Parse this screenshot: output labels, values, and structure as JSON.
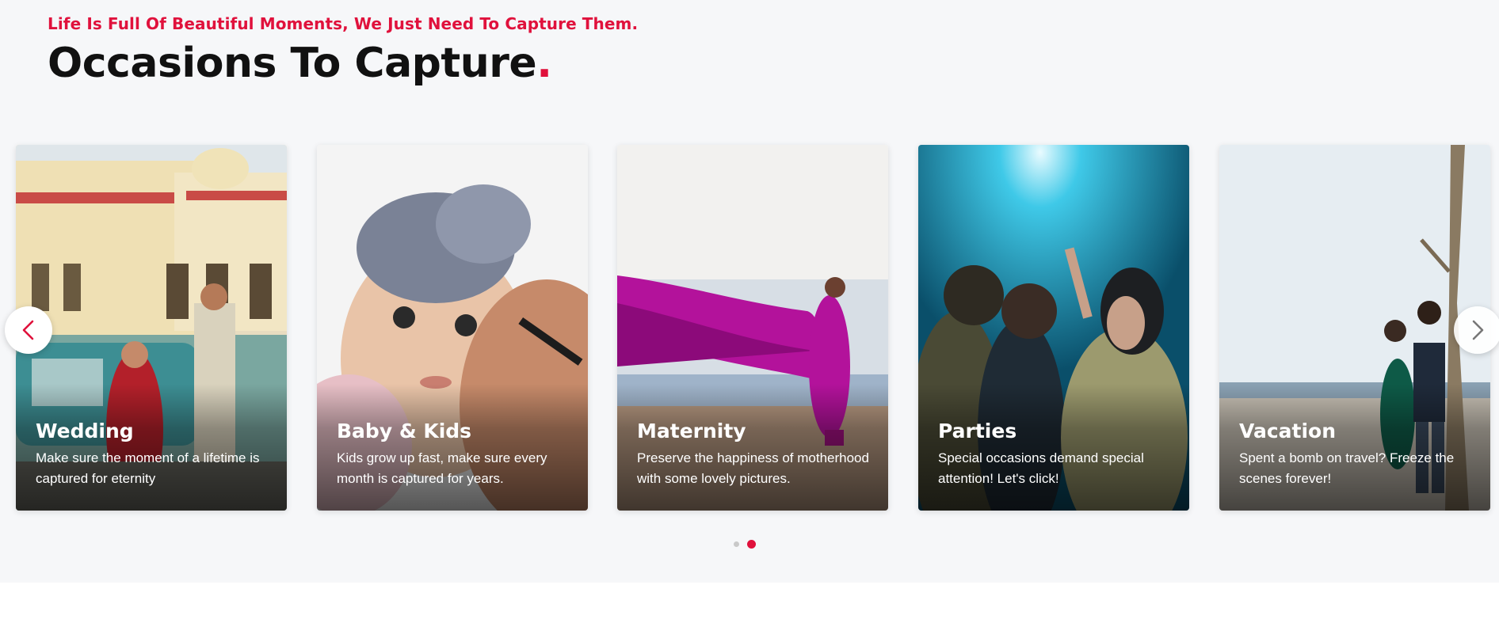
{
  "header": {
    "subtitle": "Life Is Full Of Beautiful Moments, We Just Need To Capture Them.",
    "title": "Occasions To Capture",
    "title_dot": "."
  },
  "carousel": {
    "cards": [
      {
        "title": "Wedding",
        "text": "Make sure the moment of a lifetime is captured for eternity"
      },
      {
        "title": "Baby & Kids",
        "text": "Kids grow up fast, make sure every month is captured for years."
      },
      {
        "title": "Maternity",
        "text": "Preserve the happiness of motherhood with some lovely pictures."
      },
      {
        "title": "Parties",
        "text": "Special occasions demand special attention! Let's click!"
      },
      {
        "title": "Vacation",
        "text": "Spent a bomb on travel? Freeze the scenes forever!"
      }
    ],
    "pagination": {
      "total": 2,
      "active": 2
    }
  },
  "colors": {
    "accent": "#e0113c",
    "background": "#f6f7f9"
  },
  "icons": {
    "prev": "chevron-left-icon",
    "next": "chevron-right-icon"
  }
}
